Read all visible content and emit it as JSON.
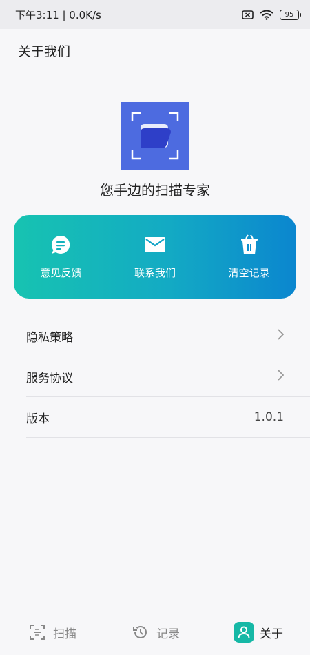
{
  "status_bar": {
    "time": "下午3:11",
    "network_speed": "0.0K/s",
    "battery": "95"
  },
  "header": {
    "title": "关于我们"
  },
  "app": {
    "tagline": "您手边的扫描专家",
    "logo_color": "#4d6be0"
  },
  "actions": [
    {
      "label": "意见反馈",
      "icon": "feedback-chat-icon"
    },
    {
      "label": "联系我们",
      "icon": "mail-icon"
    },
    {
      "label": "清空记录",
      "icon": "trash-icon"
    }
  ],
  "settings": [
    {
      "label": "隐私策略",
      "value": "",
      "icon": "chevron-right-icon"
    },
    {
      "label": "服务协议",
      "value": "",
      "icon": "chevron-right-icon"
    },
    {
      "label": "版本",
      "value": "1.0.1"
    }
  ],
  "tabs": [
    {
      "label": "扫描",
      "icon": "scan-icon",
      "active": false
    },
    {
      "label": "记录",
      "icon": "history-icon",
      "active": false
    },
    {
      "label": "关于",
      "icon": "person-icon",
      "active": true
    }
  ],
  "colors": {
    "accent": "#16b8a6",
    "gradient_start": "#17c3b1",
    "gradient_end": "#0b86cf"
  }
}
